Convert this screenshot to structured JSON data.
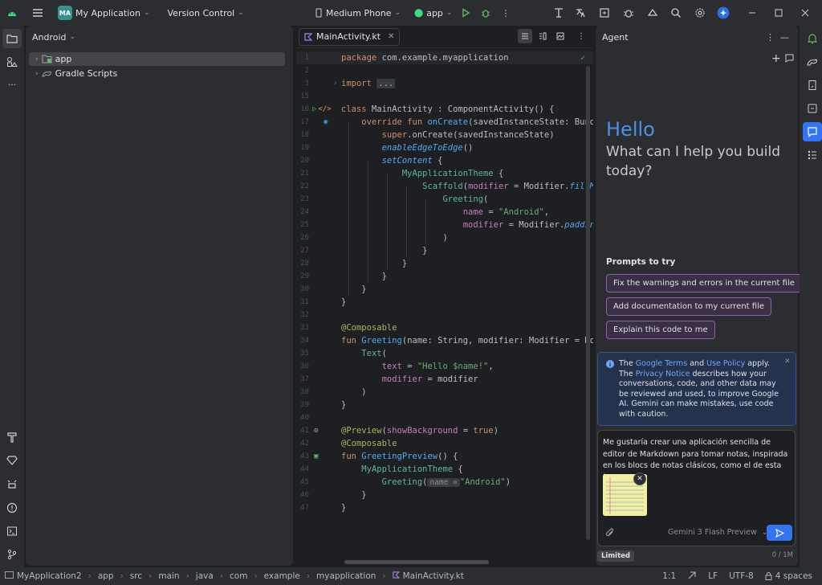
{
  "titlebar": {
    "project_badge": "MA",
    "project_name": "My Application",
    "vcs": "Version Control",
    "device": "Medium Phone",
    "run_config": "app"
  },
  "project_panel": {
    "view": "Android",
    "items": [
      {
        "label": "app",
        "selected": true
      },
      {
        "label": "Gradle Scripts",
        "selected": false
      }
    ]
  },
  "editor": {
    "tab_label": "MainActivity.kt",
    "lines": [
      {
        "n": "1"
      },
      {
        "n": "2"
      },
      {
        "n": "3"
      },
      {
        "n": "15"
      },
      {
        "n": "16"
      },
      {
        "n": "17"
      },
      {
        "n": "18"
      },
      {
        "n": "19"
      },
      {
        "n": "20"
      },
      {
        "n": "21"
      },
      {
        "n": "22"
      },
      {
        "n": "23"
      },
      {
        "n": "24"
      },
      {
        "n": "25"
      },
      {
        "n": "26"
      },
      {
        "n": "27"
      },
      {
        "n": "28"
      },
      {
        "n": "29"
      },
      {
        "n": "30"
      },
      {
        "n": "31"
      },
      {
        "n": "32"
      },
      {
        "n": "33"
      },
      {
        "n": "34"
      },
      {
        "n": "35"
      },
      {
        "n": "36"
      },
      {
        "n": "37"
      },
      {
        "n": "38"
      },
      {
        "n": "39"
      },
      {
        "n": "40"
      },
      {
        "n": "41"
      },
      {
        "n": "42"
      },
      {
        "n": "43"
      },
      {
        "n": "44"
      },
      {
        "n": "45"
      },
      {
        "n": "46"
      },
      {
        "n": "47"
      }
    ],
    "code": {
      "l1_kw": "package",
      "l1_rest": " com.example.myapplication",
      "l3_kw": "import",
      "l3_fold": "...",
      "l16_kw": "class",
      "l16_rest": " MainActivity : ComponentActivity() {",
      "l17_kw": "override fun",
      "l17_fn": "onCreate",
      "l17_rest": "(savedInstanceState: Bundle",
      "l18_kw": "super",
      "l18_rest": ".onCreate(savedInstanceState)",
      "l19_fn": "enableEdgeToEdge",
      "l19_rest": "()",
      "l20_fn": "setContent",
      "l20_rest": " {",
      "l21_cl": "MyApplicationTheme",
      "l21_rest": " {",
      "l22_cl": "Scaffold",
      "l22_a": "(",
      "l22_pm": "modifier",
      "l22_b": " = Modifier.",
      "l22_fn": "fillMax",
      "l23_cl": "Greeting",
      "l23_rest": "(",
      "l24_pm": "name",
      "l24_a": " = ",
      "l24_st": "\"Android\"",
      "l24_b": ",",
      "l25_pm": "modifier",
      "l25_a": " = Modifier.",
      "l25_fn": "padding",
      "l25_b": "(",
      "l26": ")",
      "l27": "}",
      "l28": "}",
      "l29": "}",
      "l30": "}",
      "l31": "}",
      "l33_an": "@Composable",
      "l34_kw": "fun",
      "l34_fn": "Greeting",
      "l34_rest": "(name: String, modifier: Modifier = Modi",
      "l35_cl": "Text",
      "l35_rest": "(",
      "l36_pm": "text",
      "l36_a": " = ",
      "l36_st": "\"Hello $name!\"",
      "l36_b": ",",
      "l37_pm": "modifier",
      "l37_rest": " = modifier",
      "l38": ")",
      "l39": "}",
      "l41_an": "@Preview",
      "l41_a": "(",
      "l41_pm": "showBackground",
      "l41_b": " = ",
      "l41_kw": "true",
      "l41_c": ")",
      "l42_an": "@Composable",
      "l43_kw": "fun",
      "l43_fn": "GreetingPreview",
      "l43_rest": "() {",
      "l44_cl": "MyApplicationTheme",
      "l44_rest": " {",
      "l45_cl": "Greeting",
      "l45_a": "(",
      "l45_hint": "name =",
      "l45_st": "\"Android\"",
      "l45_b": ")",
      "l46": "}",
      "l47": "}"
    }
  },
  "agent": {
    "title": "Agent",
    "hello": "Hello",
    "question": "What can I help you build today?",
    "prompts_title": "Prompts to try",
    "prompts": [
      "Fix the warnings and errors in the current file",
      "Add documentation to my current file",
      "Explain this code to me"
    ],
    "notice": {
      "t1": "The ",
      "l1": "Google Terms",
      "t2": " and ",
      "l2": "Use Policy",
      "t3": " apply. The ",
      "l3": "Privacy Notice",
      "t4": " describes how your conversations, code, and other data may be reviewed and used, to improve Google AI. Gemini can make mistakes, use code with caution."
    },
    "composer_text": "Me gustaría crear una aplicación sencilla de editor de Markdown para tomar notas, inspirada en los blocs de notas clásicos, como el de esta imagen.",
    "model": "Gemini 3 Flash Preview",
    "limited": "Limited",
    "count": "0 / 1M"
  },
  "statusbar": {
    "crumbs": [
      "MyApplication2",
      "app",
      "src",
      "main",
      "java",
      "com",
      "example",
      "myapplication",
      "MainActivity.kt"
    ],
    "position": "1:1",
    "line_sep": "LF",
    "encoding": "UTF-8",
    "indent": "4 spaces"
  },
  "colors": {
    "accent": "#3574f0",
    "hello": "#4e8fe8",
    "prompt_border": "#8e5fb2"
  }
}
